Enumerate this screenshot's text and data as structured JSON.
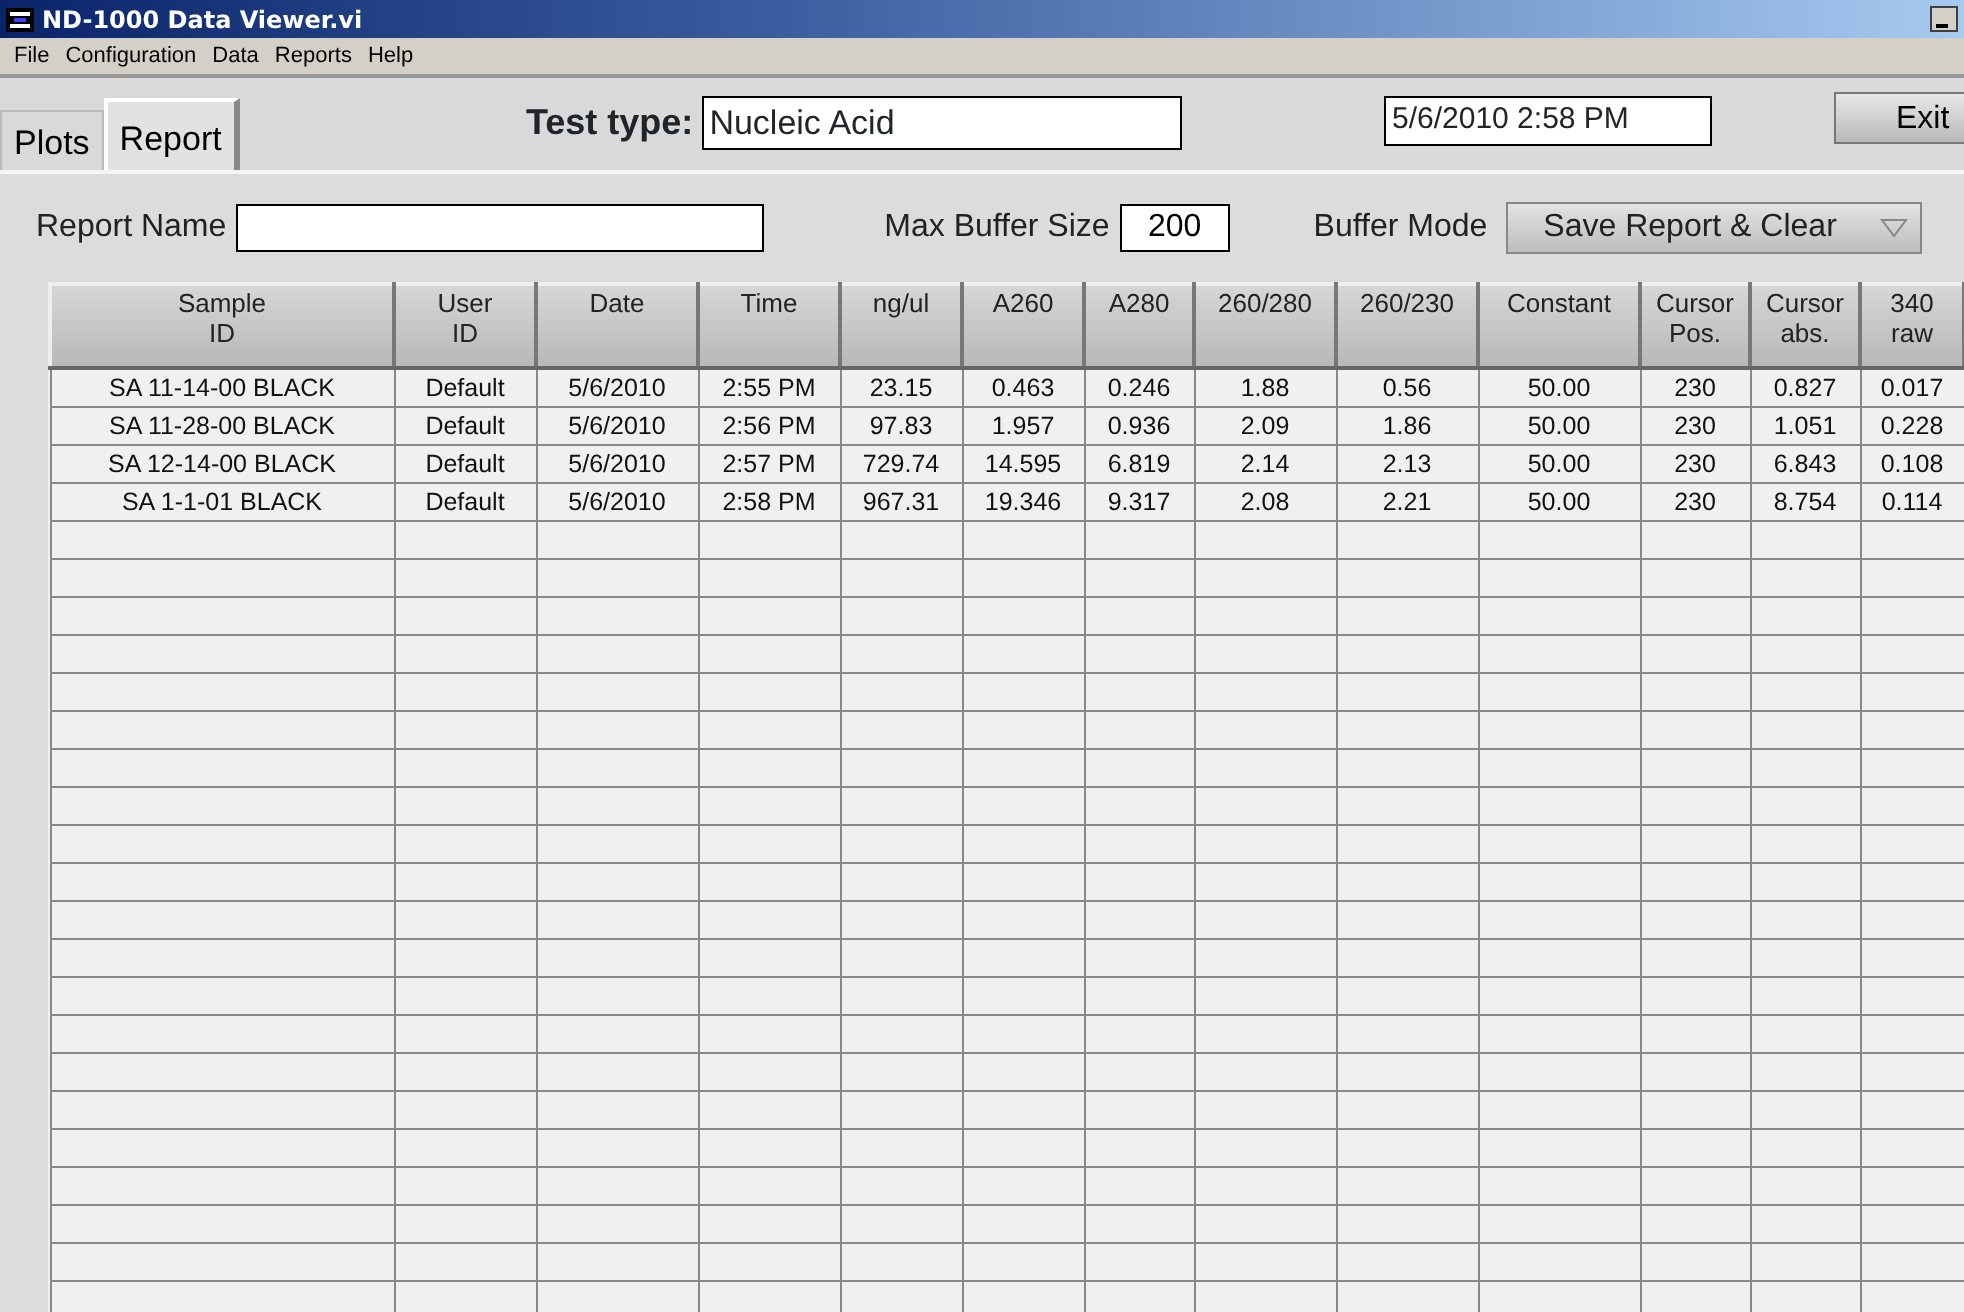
{
  "window": {
    "title": "ND-1000 Data Viewer.vi"
  },
  "menu": [
    "File",
    "Configuration",
    "Data",
    "Reports",
    "Help"
  ],
  "tabs": [
    {
      "label": "Plots",
      "selected": false
    },
    {
      "label": "Report",
      "selected": true
    }
  ],
  "test_type": {
    "label": "Test type:",
    "value": "Nucleic Acid"
  },
  "datetime": "5/6/2010  2:58 PM",
  "exit_button": "Exit",
  "report_name": {
    "label": "Report Name"
  },
  "max_buffer": {
    "label": "Max Buffer Size",
    "value": "200"
  },
  "buffer_mode": {
    "label": "Buffer Mode",
    "value": "Save Report & Clear"
  },
  "table": {
    "columns": [
      "Sample\nID",
      "User\nID",
      "Date",
      "Time",
      "ng/ul",
      "A260",
      "A280",
      "260/280",
      "260/230",
      "Constant",
      "Cursor\nPos.",
      "Cursor\nabs.",
      "340\nraw"
    ],
    "rows": [
      [
        "SA 11-14-00 BLACK",
        "Default",
        "5/6/2010",
        "2:55 PM",
        "23.15",
        "0.463",
        "0.246",
        "1.88",
        "0.56",
        "50.00",
        "230",
        "0.827",
        "0.017"
      ],
      [
        "SA 11-28-00 BLACK",
        "Default",
        "5/6/2010",
        "2:56 PM",
        "97.83",
        "1.957",
        "0.936",
        "2.09",
        "1.86",
        "50.00",
        "230",
        "1.051",
        "0.228"
      ],
      [
        "SA 12-14-00 BLACK",
        "Default",
        "5/6/2010",
        "2:57 PM",
        "729.74",
        "14.595",
        "6.819",
        "2.14",
        "2.13",
        "50.00",
        "230",
        "6.843",
        "0.108"
      ],
      [
        "SA 1-1-01 BLACK",
        "Default",
        "5/6/2010",
        "2:58 PM",
        "967.31",
        "19.346",
        "9.317",
        "2.08",
        "2.21",
        "50.00",
        "230",
        "8.754",
        "0.114"
      ]
    ]
  }
}
